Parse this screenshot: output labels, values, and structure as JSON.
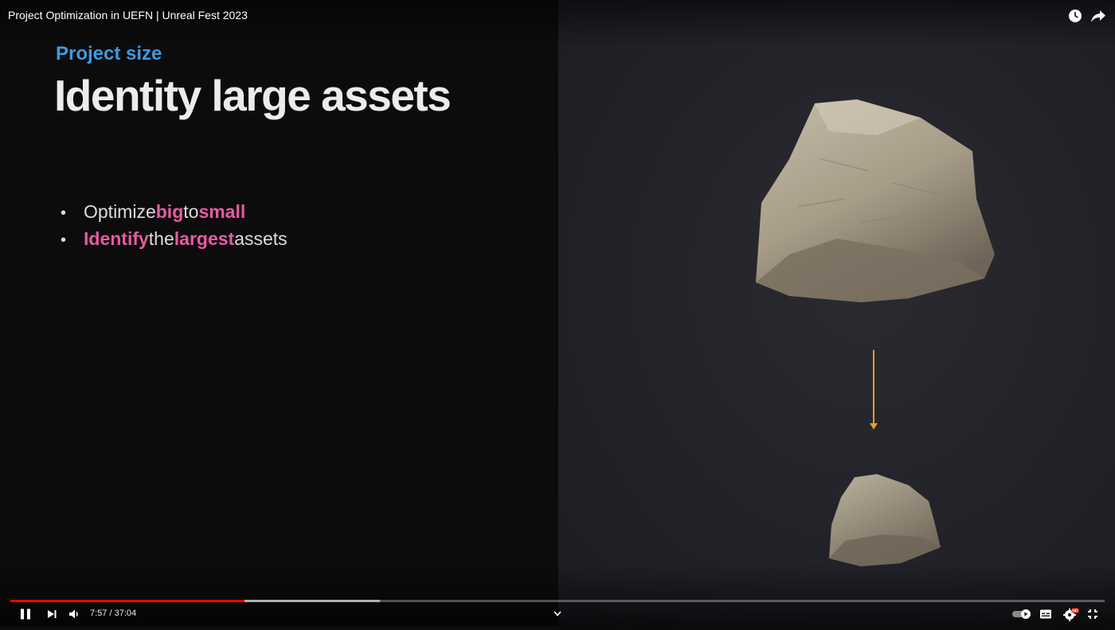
{
  "video": {
    "title": "Project Optimization in UEFN | Unreal Fest 2023"
  },
  "slide": {
    "eyebrow": "Project size",
    "headline": "Identity large assets",
    "bullets": [
      {
        "parts": [
          {
            "text": "Optimize ",
            "hl": false
          },
          {
            "text": "big",
            "hl": true
          },
          {
            "text": " to ",
            "hl": false
          },
          {
            "text": "small",
            "hl": true
          }
        ]
      },
      {
        "parts": [
          {
            "text": "Identify",
            "hl": true
          },
          {
            "text": " the ",
            "hl": false
          },
          {
            "text": "largest",
            "hl": true
          },
          {
            "text": " assets",
            "hl": false
          }
        ]
      }
    ],
    "colors": {
      "eyebrow": "#3d9be0",
      "highlight": "#e85aa4",
      "arrow": "#e3a21a"
    }
  },
  "player": {
    "time_display": "7:57 / 37:04",
    "progress_played": 0.214,
    "progress_buffered": 0.338,
    "icons": [
      "watch-later-icon",
      "share-icon",
      "pause-icon",
      "next-icon",
      "volume-icon",
      "chevron-down-icon",
      "autoplay-toggle-icon",
      "captions-icon",
      "settings-icon",
      "exit-fullscreen-icon"
    ],
    "settings_badge": "HD"
  }
}
